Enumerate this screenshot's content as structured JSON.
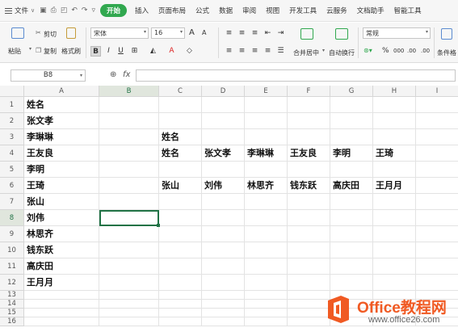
{
  "menubar": {
    "file_label": "文件",
    "active_tab": "开始",
    "tabs": [
      "插入",
      "页面布局",
      "公式",
      "数据",
      "审阅",
      "视图",
      "开发工具",
      "云服务",
      "文档助手",
      "智能工具"
    ]
  },
  "toolbar": {
    "paste_label": "粘贴",
    "cut_label": "剪切",
    "copy_label": "复制",
    "format_painter_label": "格式刷",
    "font_name": "宋体",
    "font_size": "16",
    "bold_label": "B",
    "italic_label": "I",
    "underline_label": "U",
    "grow_font_label": "A",
    "shrink_font_label": "A",
    "merge_label": "合并居中",
    "wrap_label": "自动换行",
    "number_format": "常规",
    "percent_label": "%",
    "comma_label": "000",
    "inc_decimal_label": ".00",
    "dec_decimal_label": ".00",
    "cond_format_label": "条件格"
  },
  "formula_bar": {
    "name_box": "B8",
    "fx_label": "fx",
    "formula": ""
  },
  "grid": {
    "columns": [
      "A",
      "B",
      "C",
      "D",
      "E",
      "F",
      "G",
      "H",
      "I"
    ],
    "selected_column": "B",
    "selected_row": 8,
    "rows": [
      {
        "num": "1",
        "cells": [
          "姓名",
          "",
          "",
          "",
          "",
          "",
          "",
          "",
          ""
        ]
      },
      {
        "num": "2",
        "cells": [
          "张文孝",
          "",
          "",
          "",
          "",
          "",
          "",
          "",
          ""
        ]
      },
      {
        "num": "3",
        "cells": [
          "李琳琳",
          "",
          "姓名",
          "",
          "",
          "",
          "",
          "",
          ""
        ]
      },
      {
        "num": "4",
        "cells": [
          "王友良",
          "",
          "姓名",
          "张文孝",
          "李琳琳",
          "王友良",
          "李明",
          "王琦",
          ""
        ]
      },
      {
        "num": "5",
        "cells": [
          "李明",
          "",
          "",
          "",
          "",
          "",
          "",
          "",
          ""
        ]
      },
      {
        "num": "6",
        "cells": [
          "王琦",
          "",
          "张山",
          "刘伟",
          "林思齐",
          "钱东跃",
          "高庆田",
          "王月月",
          ""
        ]
      },
      {
        "num": "7",
        "cells": [
          "张山",
          "",
          "",
          "",
          "",
          "",
          "",
          "",
          ""
        ]
      },
      {
        "num": "8",
        "cells": [
          "刘伟",
          "",
          "",
          "",
          "",
          "",
          "",
          "",
          ""
        ]
      },
      {
        "num": "9",
        "cells": [
          "林思齐",
          "",
          "",
          "",
          "",
          "",
          "",
          "",
          ""
        ]
      },
      {
        "num": "10",
        "cells": [
          "钱东跃",
          "",
          "",
          "",
          "",
          "",
          "",
          "",
          ""
        ]
      },
      {
        "num": "11",
        "cells": [
          "高庆田",
          "",
          "",
          "",
          "",
          "",
          "",
          "",
          ""
        ]
      },
      {
        "num": "12",
        "cells": [
          "王月月",
          "",
          "",
          "",
          "",
          "",
          "",
          "",
          ""
        ]
      },
      {
        "num": "13",
        "cells": [
          "",
          "",
          "",
          "",
          "",
          "",
          "",
          "",
          ""
        ]
      },
      {
        "num": "14",
        "cells": [
          "",
          "",
          "",
          "",
          "",
          "",
          "",
          "",
          ""
        ]
      },
      {
        "num": "15",
        "cells": [
          "",
          "",
          "",
          "",
          "",
          "",
          "",
          "",
          ""
        ]
      },
      {
        "num": "16",
        "cells": [
          "",
          "",
          "",
          "",
          "",
          "",
          "",
          "",
          ""
        ]
      }
    ]
  },
  "watermark": {
    "brand": "Office教程网",
    "url": "www.office26.com"
  },
  "colors": {
    "accent": "#31a84f",
    "selection": "#217346",
    "watermark": "#f05a23"
  }
}
